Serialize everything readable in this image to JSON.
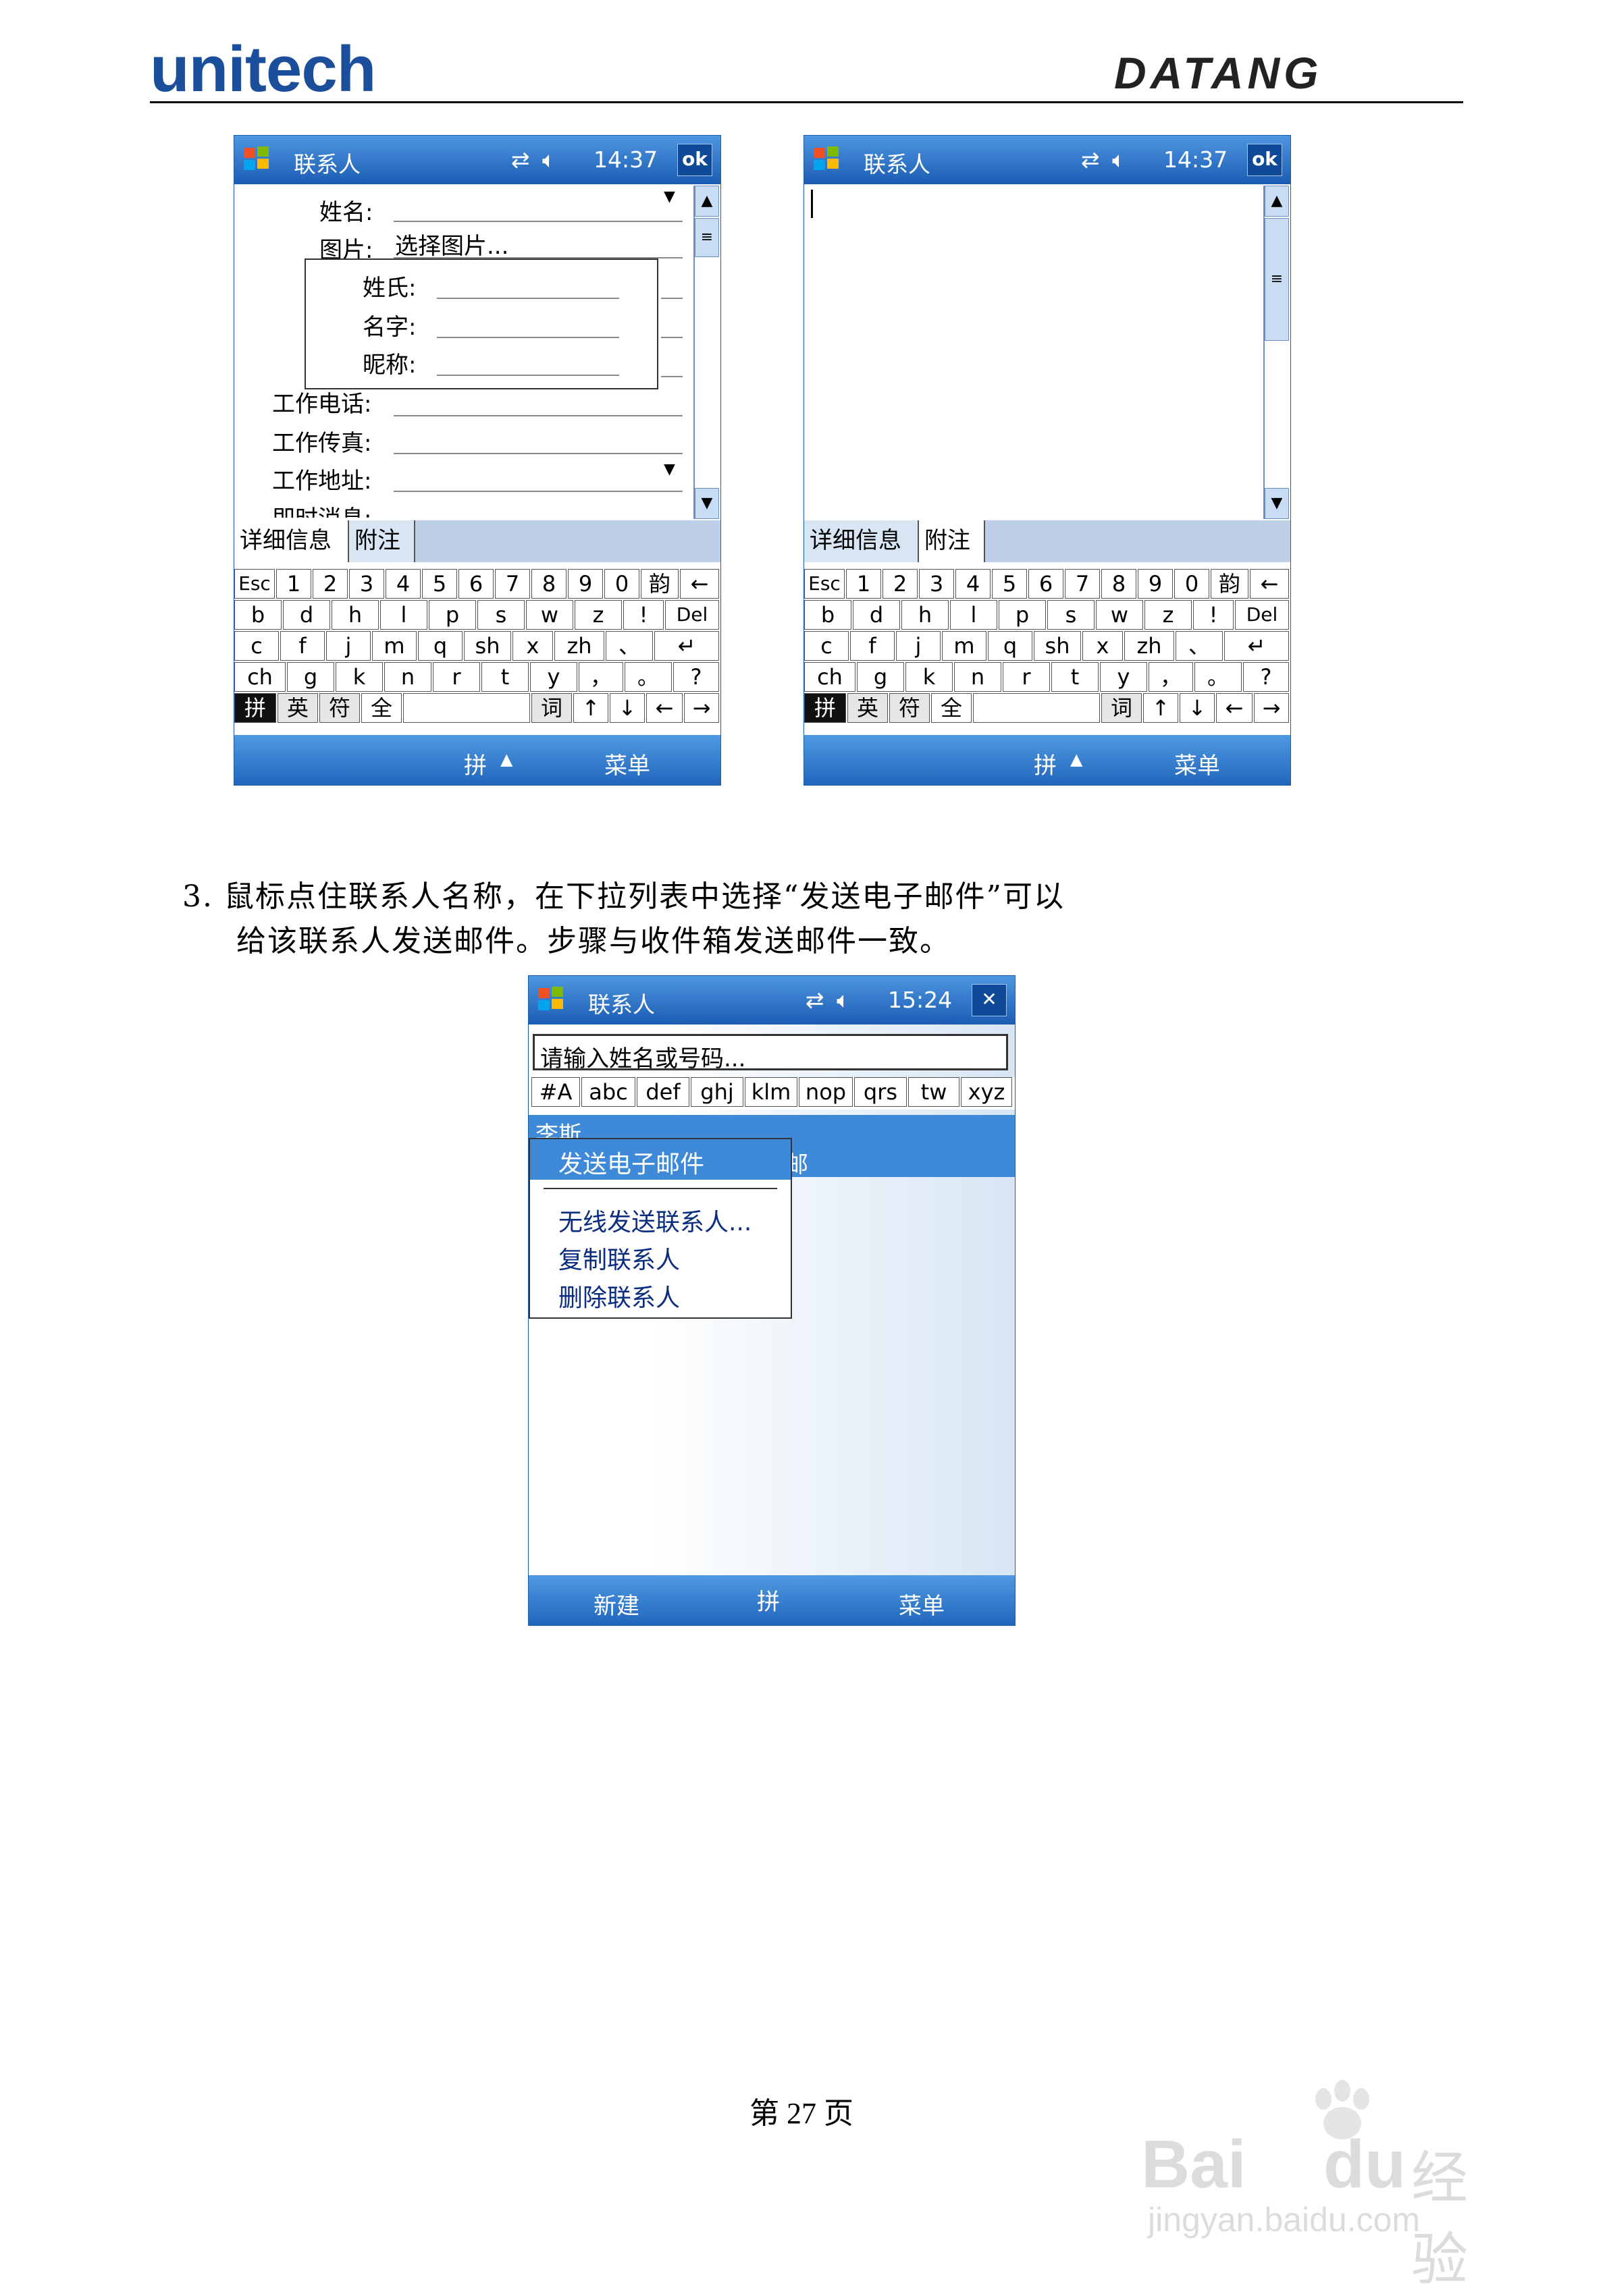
{
  "header": {
    "brand_left": "unitech",
    "brand_right": "DATANG"
  },
  "screens": [
    {
      "title": "联系人",
      "time": "14:37",
      "ok": "ok",
      "fields": {
        "name": "姓名:",
        "picture": "图片:",
        "picture_value": "选择图片...",
        "surname": "姓氏:",
        "given": "名字:",
        "nick": "昵称:",
        "work_phone": "工作电话:",
        "work_fax": "工作传真:",
        "work_addr": "工作地址:",
        "im": "即时消息:"
      },
      "tabs": [
        "详细信息",
        "附注"
      ],
      "bottom": {
        "left": "拼",
        "right": "菜单"
      }
    },
    {
      "title": "联系人",
      "time": "14:37",
      "ok": "ok",
      "tabs": [
        "详细信息",
        "附注"
      ],
      "bottom": {
        "left": "拼",
        "right": "菜单"
      }
    }
  ],
  "keyboard": {
    "row1": [
      "Esc",
      "1",
      "2",
      "3",
      "4",
      "5",
      "6",
      "7",
      "8",
      "9",
      "0",
      "韵",
      "←"
    ],
    "row2": [
      "b",
      "d",
      "h",
      "l",
      "p",
      "s",
      "w",
      "z",
      "!",
      "Del"
    ],
    "row3": [
      "c",
      "f",
      "j",
      "m",
      "q",
      "sh",
      "x",
      "zh",
      "、",
      "↵"
    ],
    "row4": [
      "ch",
      "g",
      "k",
      "n",
      "r",
      "t",
      "y",
      "，",
      "。",
      "?"
    ],
    "row5": [
      "拼",
      "英",
      "符",
      "全",
      "",
      "词",
      "↑",
      "↓",
      "←",
      "→"
    ]
  },
  "paragraph": {
    "line1": "3.  鼠标点住联系人名称，在下拉列表中选择“发送电子邮件”可以",
    "line2": "给该联系人发送邮件。步骤与收件箱发送邮件一致。"
  },
  "screen3": {
    "title": "联系人",
    "time": "15:24",
    "close": "✕",
    "search_placeholder": "请输入姓名或号码...",
    "letters": [
      "#A",
      "abc",
      "def",
      "ghj",
      "klm",
      "nop",
      "qrs",
      "tw",
      "xyz"
    ],
    "list_partial": "李斯",
    "list_partial2": "邮",
    "menu": [
      "发送电子邮件",
      "无线发送联系人...",
      "复制联系人",
      "删除联系人"
    ],
    "bottom": {
      "left": "新建",
      "center": "拼",
      "right": "菜单"
    }
  },
  "footer": {
    "page": "第 27 页"
  },
  "watermark": {
    "brand": "Bai",
    "brand2": "du",
    "jingyan": "经验",
    "url": "jingyan.baidu.com"
  },
  "colors": {
    "brand_blue": "#1b4f9c",
    "bar_blue": "#2166bd",
    "selection": "#3f8ad8"
  }
}
